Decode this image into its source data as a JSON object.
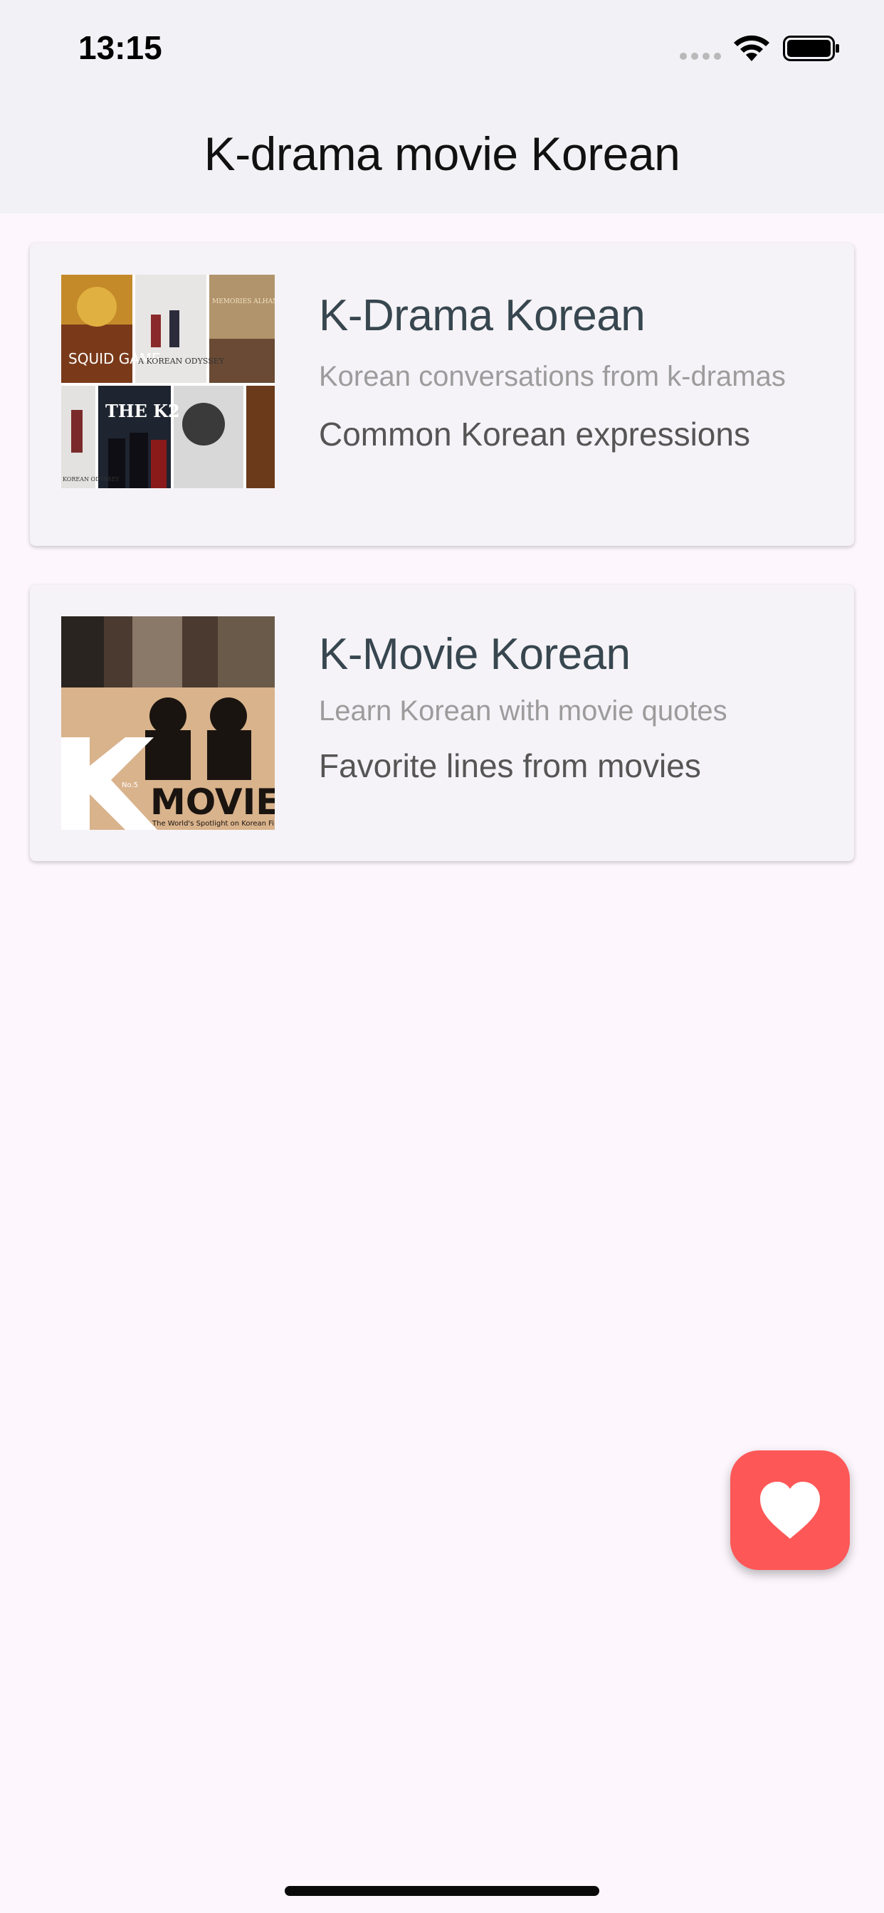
{
  "status_bar": {
    "time": "13:15"
  },
  "app_bar": {
    "title": "K-drama movie Korean"
  },
  "cards": [
    {
      "title": "K-Drama Korean",
      "subtitle": "Korean conversations from k-dramas",
      "caption": "Common Korean expressions",
      "thumbnail": {
        "poster_texts": [
          "SQUID GAME",
          "A KOREAN ODYSSEY",
          "MEMORIES ALHAMBRA",
          "THE K2",
          "KOREAN ODYSSEY"
        ]
      }
    },
    {
      "title": "K-Movie Korean",
      "subtitle": "Learn Korean with movie quotes",
      "caption": "Favorite lines from movies",
      "thumbnail": {
        "letter": "K",
        "word": "MOVIE",
        "tagline": "The World's Spotlight on Korean Film",
        "issue": "No.5"
      }
    }
  ],
  "fab": {
    "icon": "heart-icon",
    "color": "#fe5757"
  },
  "colors": {
    "background": "#fdf7fd",
    "app_bar": "#f2f2f6",
    "card": "#f5f3f7",
    "title": "#37464f"
  }
}
